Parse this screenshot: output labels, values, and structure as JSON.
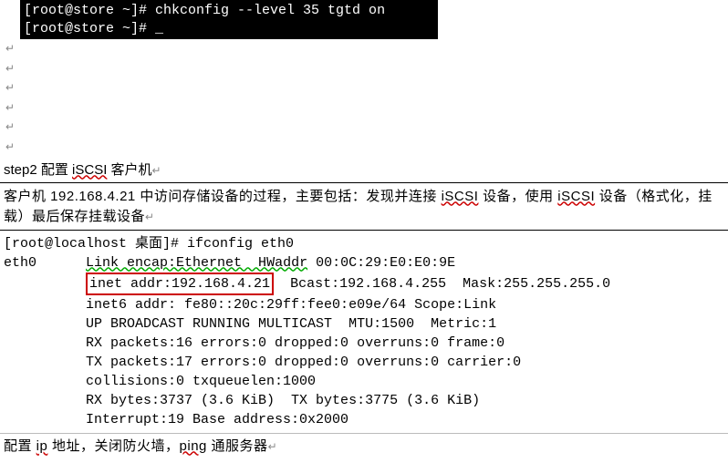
{
  "terminal1": {
    "line1": "[root@store ~]# chkconfig --level 35 tgtd on",
    "line2": "[root@store ~]# _"
  },
  "step_title": {
    "prefix": "step2 配置 ",
    "iscsi": "iSCSI",
    "suffix": " 客户机"
  },
  "client_text": {
    "p1_a": "客户机 192.168.4.21 中访问存储设备的过程，主要包括：发现并连接 ",
    "iscsi1": "iSCSI",
    "p1_b": " 设备，使用 ",
    "iscsi2": "iSCSI",
    "p1_c": " 设备（格式化，挂载）最后保存挂载设备"
  },
  "ifconfig": {
    "cmd": "[root@localhost 桌面]# ifconfig eth0",
    "eth0_label": "eth0",
    "l1a": "Link encap:Ethernet  HWaddr",
    "l1b": " 00:0C:29:E0:E0:9E",
    "l2_boxed": "inet addr:192.168.4.21",
    "l2_rest": "  Bcast:192.168.4.255  Mask:255.255.255.0",
    "l3": "inet6 addr: fe80::20c:29ff:fee0:e09e/64 Scope:Link",
    "l4": "UP BROADCAST RUNNING MULTICAST  MTU:1500  Metric:1",
    "l5": "RX packets:16 errors:0 dropped:0 overruns:0 frame:0",
    "l6": "TX packets:17 errors:0 dropped:0 overruns:0 carrier:0",
    "l7": "collisions:0 txqueuelen:1000",
    "l8": "RX bytes:3737 (3.6 KiB)  TX bytes:3775 (3.6 KiB)",
    "l9": "Interrupt:19 Base address:0x2000"
  },
  "footer": {
    "a": "配置 ",
    "ip": "ip",
    "b": " 地址，关闭防火墙，",
    "ping": "ping",
    "c": " 通服务器"
  }
}
